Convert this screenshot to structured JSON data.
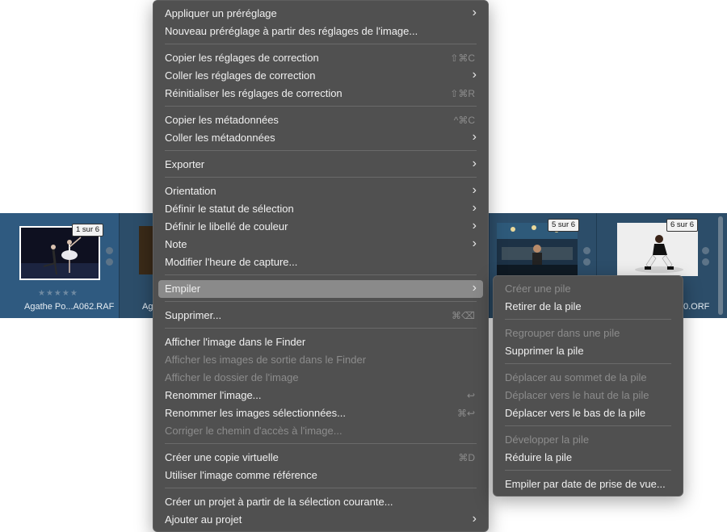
{
  "filmstrip": {
    "thumbs": [
      {
        "badge": "1 sur 6",
        "stars": "★★★★★",
        "name": "Agathe Po...A062.RAF"
      },
      {
        "name": "Ag"
      },
      {
        "badge": "5 sur 6"
      },
      {
        "badge": "6 sur 6",
        "name": "0.ORF"
      }
    ]
  },
  "context_menu": {
    "items": [
      {
        "label": "Appliquer un préréglage",
        "submenu": "›"
      },
      {
        "label": "Nouveau préréglage à partir des réglages de l'image..."
      },
      {
        "label": "Copier les réglages de correction",
        "shortcut": "⇧⌘C"
      },
      {
        "label": "Coller les réglages de correction",
        "submenu": "›"
      },
      {
        "label": "Réinitialiser les réglages de correction",
        "shortcut": "⇧⌘R"
      },
      {
        "label": "Copier les métadonnées",
        "shortcut": "^⌘C"
      },
      {
        "label": "Coller les métadonnées",
        "submenu": "›"
      },
      {
        "label": "Exporter",
        "submenu": "›"
      },
      {
        "label": "Orientation",
        "submenu": "›"
      },
      {
        "label": "Définir le statut de sélection",
        "submenu": "›"
      },
      {
        "label": "Définir le libellé de couleur",
        "submenu": "›"
      },
      {
        "label": "Note",
        "submenu": "›"
      },
      {
        "label": "Modifier l'heure de capture..."
      },
      {
        "label": "Empiler",
        "submenu": "›"
      },
      {
        "label": "Supprimer...",
        "shortcut": "⌘⌫"
      },
      {
        "label": "Afficher l'image dans le Finder"
      },
      {
        "label": "Afficher les images de sortie dans le Finder"
      },
      {
        "label": "Afficher le dossier de l'image"
      },
      {
        "label": "Renommer l'image...",
        "shortcut": "↩"
      },
      {
        "label": "Renommer les images sélectionnées...",
        "shortcut": "⌘↩"
      },
      {
        "label": "Corriger le chemin d'accès à l'image..."
      },
      {
        "label": "Créer une copie virtuelle",
        "shortcut": "⌘D"
      },
      {
        "label": "Utiliser l'image comme référence"
      },
      {
        "label": "Créer un projet à partir de la sélection courante..."
      },
      {
        "label": "Ajouter au projet",
        "submenu": "›"
      }
    ]
  },
  "stack_submenu": {
    "items": [
      {
        "label": "Créer une pile"
      },
      {
        "label": "Retirer de la pile"
      },
      {
        "label": "Regrouper dans une pile"
      },
      {
        "label": "Supprimer la pile"
      },
      {
        "label": "Déplacer au sommet de la pile"
      },
      {
        "label": "Déplacer vers le haut de la pile"
      },
      {
        "label": "Déplacer vers le bas de la pile"
      },
      {
        "label": "Développer la pile"
      },
      {
        "label": "Réduire la pile"
      },
      {
        "label": "Empiler par date de prise de vue..."
      }
    ]
  }
}
